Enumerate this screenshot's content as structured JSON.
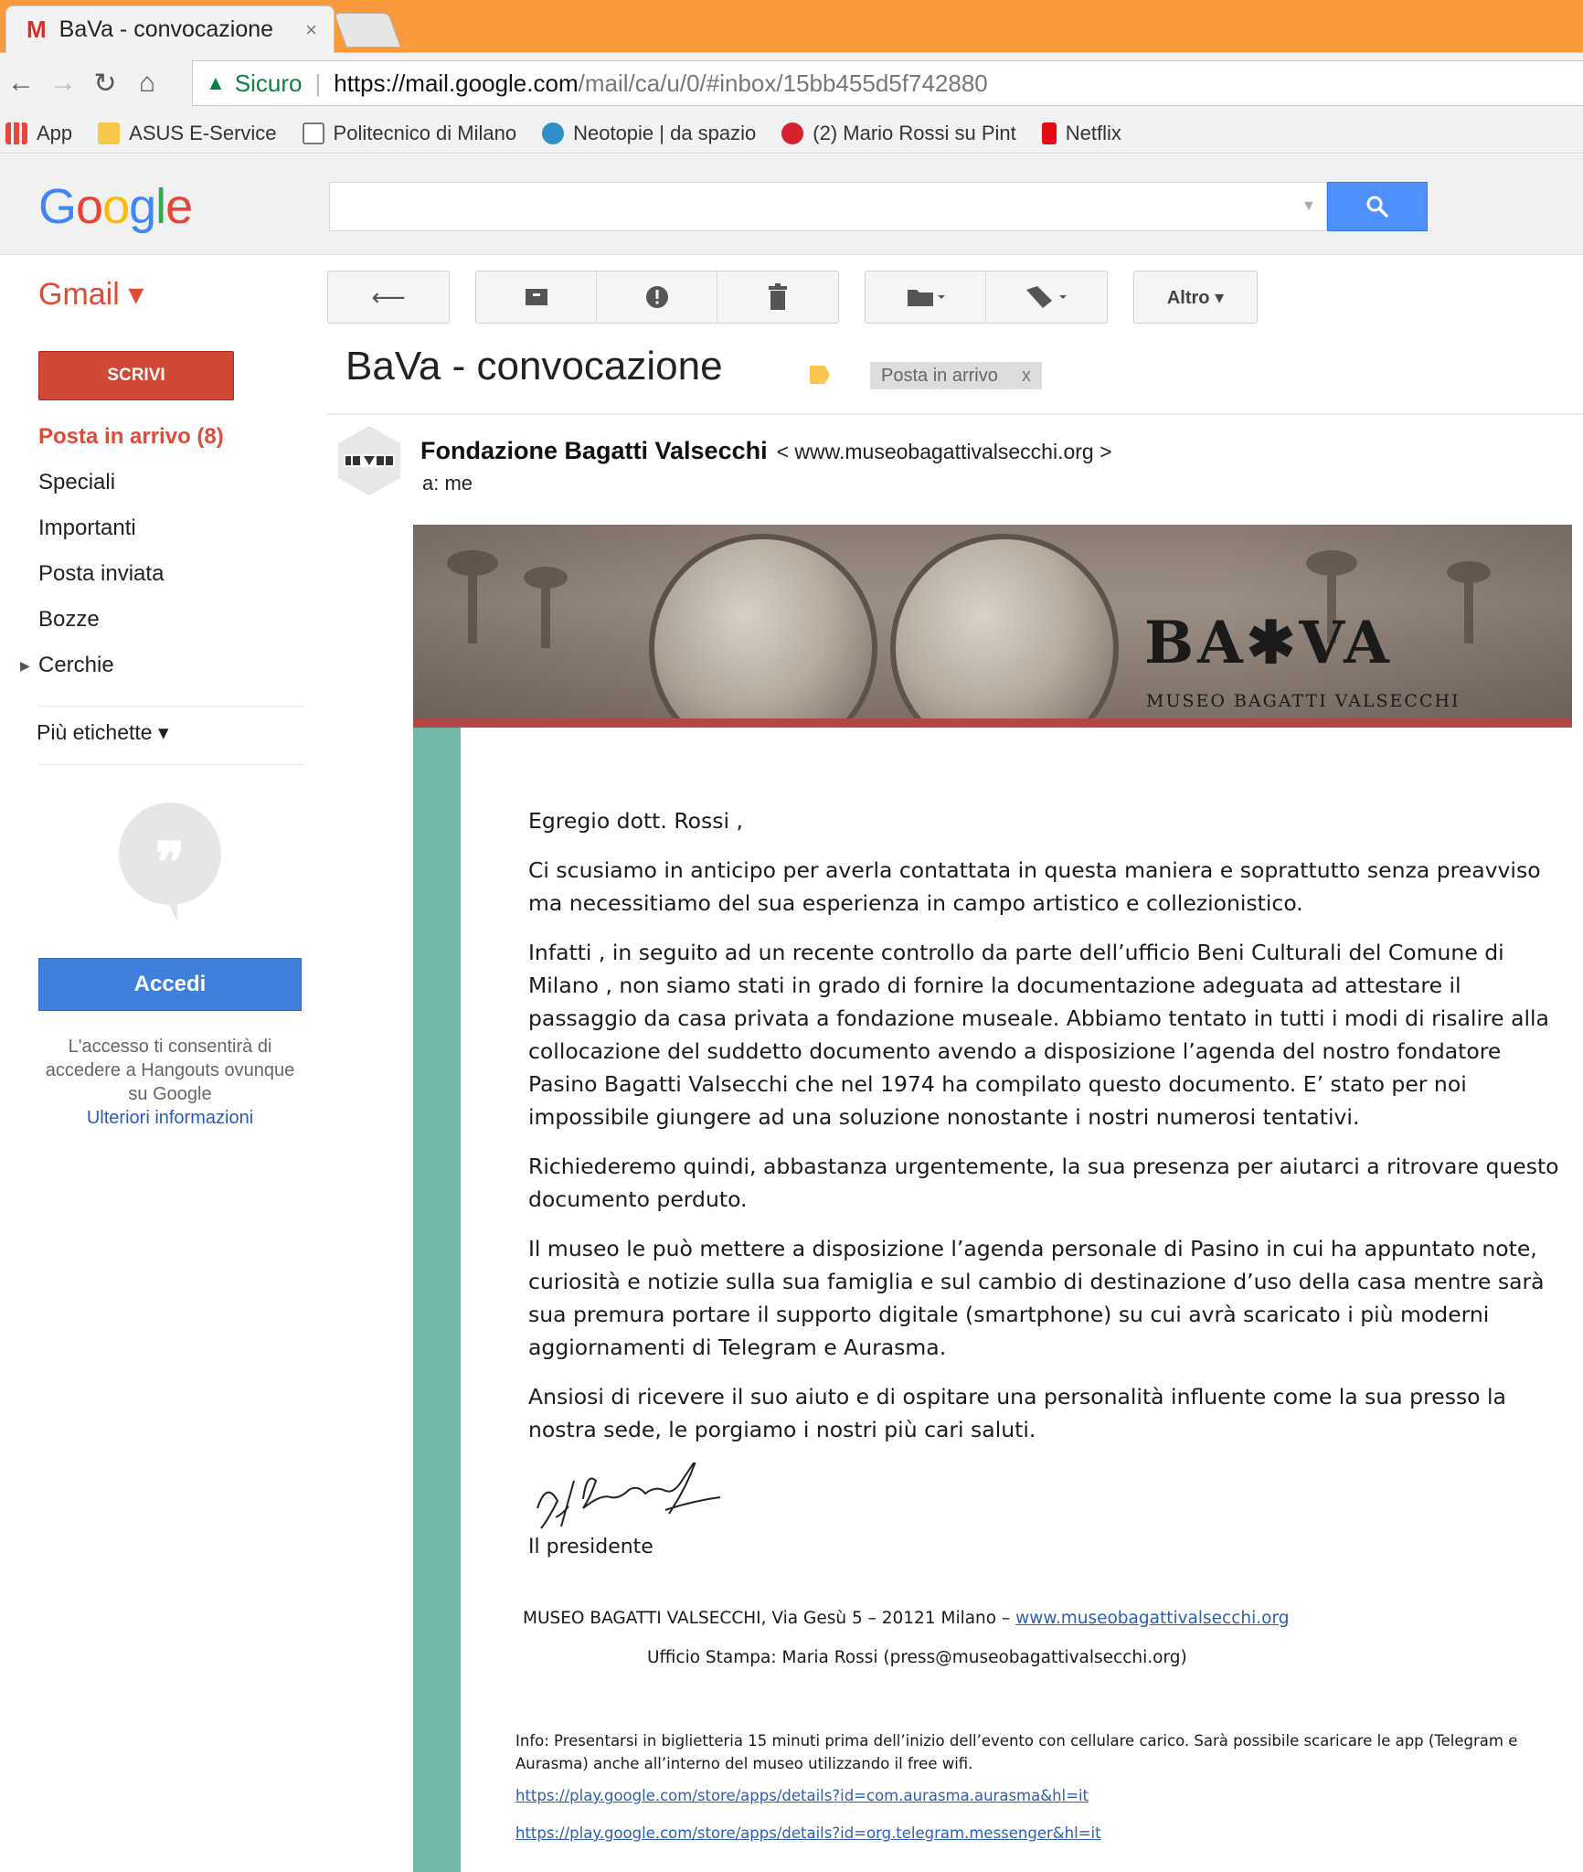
{
  "browser": {
    "tab_title": "BaVa - convocazione",
    "tab_close": "×",
    "favicon": "M",
    "secure_label": "Sicuro",
    "url_host": "https://mail.google.com",
    "url_path": "/mail/ca/u/0/#inbox/15bb455d5f742880",
    "bookmarks": [
      {
        "label": "App",
        "icon": "apps-icon"
      },
      {
        "label": "ASUS E-Service",
        "icon": "folder-icon"
      },
      {
        "label": "Politecnico di Milano",
        "icon": "page-icon"
      },
      {
        "label": "Neotopie | da spazio",
        "icon": "wordpress-icon"
      },
      {
        "label": "(2) Mario Rossi su Pint",
        "icon": "pinterest-icon"
      },
      {
        "label": "Netflix",
        "icon": "netflix-icon"
      }
    ]
  },
  "gmail": {
    "brand": "Gmail ▾",
    "compose_label": "SCRIVI",
    "more_label": "Altro ▾",
    "nav": [
      {
        "label": "Posta in arrivo (8)",
        "active": true
      },
      {
        "label": "Speciali"
      },
      {
        "label": "Importanti"
      },
      {
        "label": "Posta inviata"
      },
      {
        "label": "Bozze"
      },
      {
        "label": "Cerchie"
      }
    ],
    "more_labels": "Più etichette ▾",
    "hangouts": {
      "login_label": "Accedi",
      "note": "L'accesso ti consentirà di accedere a Hangouts ovunque su Google",
      "more_info": "Ulteriori informazioni"
    }
  },
  "message": {
    "subject": "BaVa - convocazione",
    "inbox_chip": "Posta in arrivo",
    "chip_close": "x",
    "sender_name": "Fondazione Bagatti Valsecchi",
    "sender_email": "< www.museobagattivalsecchi.org >",
    "recipient": "a: me",
    "banner_logo": "BA✱VA",
    "banner_sub": "MUSEO BAGATTI VALSECCHI",
    "greeting": "Egregio dott. Rossi ,",
    "paragraphs": [
      "Ci scusiamo in anticipo per averla contattata in questa maniera e soprattutto senza preavviso ma necessitiamo del sua esperienza in campo artistico e collezionistico.",
      "Infatti , in seguito ad un recente controllo da parte dell’ufficio Beni Culturali del Comune di Milano , non siamo stati in grado di fornire la documentazione adeguata ad attestare il passaggio da casa privata a fondazione museale. Abbiamo tentato in tutti i modi di risalire alla collocazione del suddetto documento avendo a disposizione l’agenda del nostro fondatore Pasino Bagatti Valsecchi che nel 1974 ha compilato questo documento. E’ stato per noi impossibile giungere ad una soluzione nonostante i nostri numerosi tentativi.",
      "Richiederemo quindi, abbastanza urgentemente, la sua presenza per aiutarci a ritrovare questo documento perduto.",
      "Il museo le può mettere a disposizione l’agenda personale di Pasino in cui ha appuntato note, curiosità e notizie sulla sua famiglia e sul cambio di destinazione d’uso della casa mentre sarà sua premura portare il supporto digitale (smartphone) su cui avrà scaricato i più moderni aggiornamenti di Telegram e Aurasma.",
      "Ansiosi di ricevere il suo aiuto e di ospitare una personalità influente come la sua presso la nostra sede, le porgiamo i nostri più cari saluti."
    ],
    "signoff": "Il presidente",
    "footer_address": "MUSEO BAGATTI VALSECCHI, Via Gesù 5 – 20121 Milano –",
    "footer_site": "www.museobagattivalsecchi.org",
    "footer_press": "Ufficio Stampa: Maria Rossi (press@museobagattivalsecchi.org)",
    "info": "Info: Presentarsi in biglietteria 15 minuti prima dell’inizio dell’evento con cellulare carico. Sarà possibile scaricare le app (Telegram e Aurasma) anche all’interno del museo utilizzando il free wifi.",
    "link_aurasma": "https://play.google.com/store/apps/details?id=com.aurasma.aurasma&hl=it",
    "link_telegram": "https://play.google.com/store/apps/details?id=org.telegram.messenger&hl=it"
  }
}
